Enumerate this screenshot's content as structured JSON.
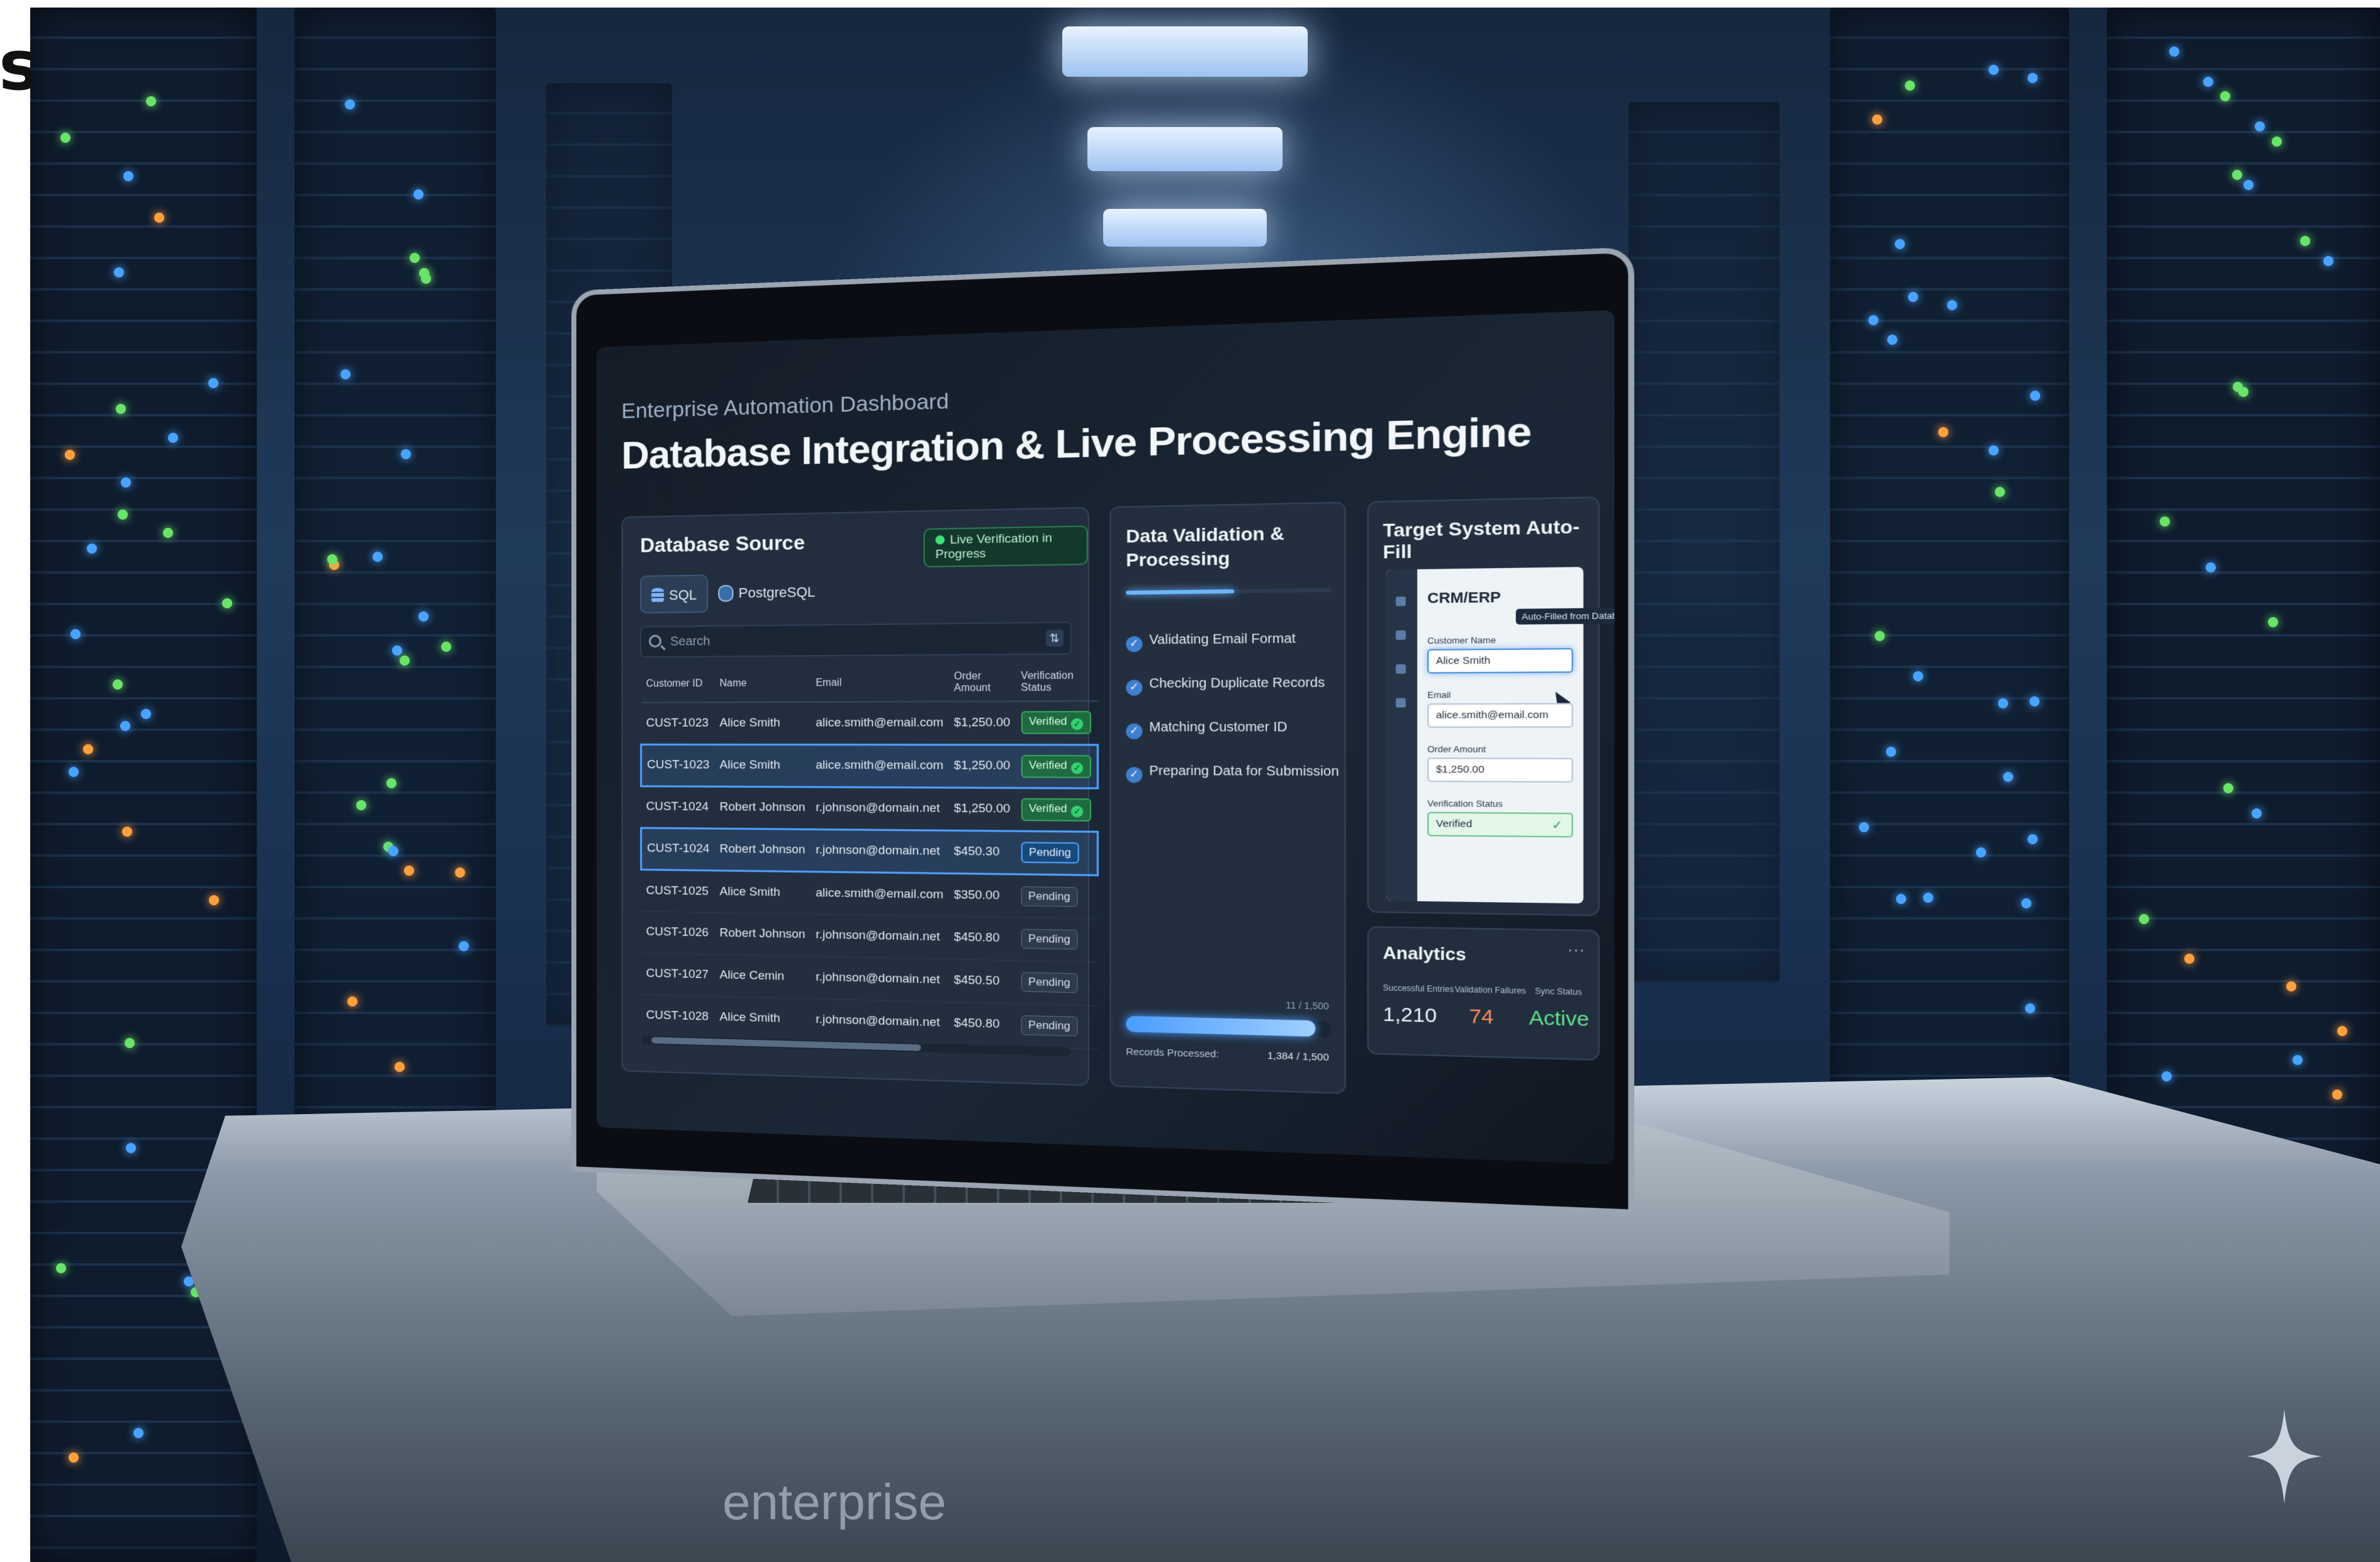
{
  "dashboard": {
    "subtitle": "Enterprise Automation Dashboard",
    "title": "Database Integration & Live Processing Engine"
  },
  "source": {
    "title": "Database Source",
    "live_badge": "Live Verification in Progress",
    "tabs": [
      {
        "label": "SQL",
        "icon": "database-icon",
        "active": true
      },
      {
        "label": "PostgreSQL",
        "icon": "postgresql-icon",
        "active": false
      }
    ],
    "search_placeholder": "Search",
    "columns": [
      "Customer ID",
      "Name",
      "Email",
      "Order Amount",
      "Verification Status"
    ],
    "rows": [
      {
        "id": "CUST-1023",
        "name": "Alice Smith",
        "email": "alice.smith@email.com",
        "amount": "$1,250.00",
        "status": "Verified",
        "highlight": false
      },
      {
        "id": "CUST-1023",
        "name": "Alice Smith",
        "email": "alice.smith@email.com",
        "amount": "$1,250.00",
        "status": "Verified",
        "highlight": true
      },
      {
        "id": "CUST-1024",
        "name": "Robert Johnson",
        "email": "r.johnson@domain.net",
        "amount": "$1,250.00",
        "status": "Verified",
        "highlight": false
      },
      {
        "id": "CUST-1024",
        "name": "Robert Johnson",
        "email": "r.johnson@domain.net",
        "amount": "$450.30",
        "status": "Pending",
        "highlight": true
      },
      {
        "id": "CUST-1025",
        "name": "Alice Smith",
        "email": "alice.smith@email.com",
        "amount": "$350.00",
        "status": "Pending",
        "highlight": false
      },
      {
        "id": "CUST-1026",
        "name": "Robert Johnson",
        "email": "r.johnson@domain.net",
        "amount": "$450.80",
        "status": "Pending",
        "highlight": false
      },
      {
        "id": "CUST-1027",
        "name": "Alice Cemin",
        "email": "r.johnson@domain.net",
        "amount": "$450.50",
        "status": "Pending",
        "highlight": false
      },
      {
        "id": "CUST-1028",
        "name": "Alice Smith",
        "email": "r.johnson@domain.net",
        "amount": "$450.80",
        "status": "Pending",
        "highlight": false
      }
    ]
  },
  "processing": {
    "title": "Data Validation & Processing",
    "stage_progress": 0.53,
    "steps": [
      "Validating Email Format",
      "Checking Duplicate Records",
      "Matching Customer ID",
      "Preparing Data for Submission"
    ],
    "records_label": "Records Processed:",
    "records_count": "1,384 / 1,500",
    "records_top": "11 / 1,500",
    "records_progress": 0.9227
  },
  "target": {
    "title": "Target System Auto-Fill",
    "system": "CRM/ERP",
    "autofill_badge": "Auto-Filled from Database",
    "fields": {
      "name_label": "Customer Name",
      "name_value": "Alice Smith",
      "email_label": "Email",
      "email_value": "alice.smith@email.com",
      "amount_label": "Order Amount",
      "amount_value": "$1,250.00",
      "status_label": "Verification Status",
      "status_value": "Verified"
    }
  },
  "analytics": {
    "title": "Analytics",
    "metrics": [
      {
        "label": "Successful Entries",
        "value": "1,210",
        "color": "#e8f0f8"
      },
      {
        "label": "Validation Failures",
        "value": "74",
        "color": "#ff8a5c"
      },
      {
        "label": "Sync Status",
        "value": "Active",
        "color": "#5fe08a"
      }
    ]
  },
  "table_logo": "enterprise",
  "edge_glyph": "s"
}
